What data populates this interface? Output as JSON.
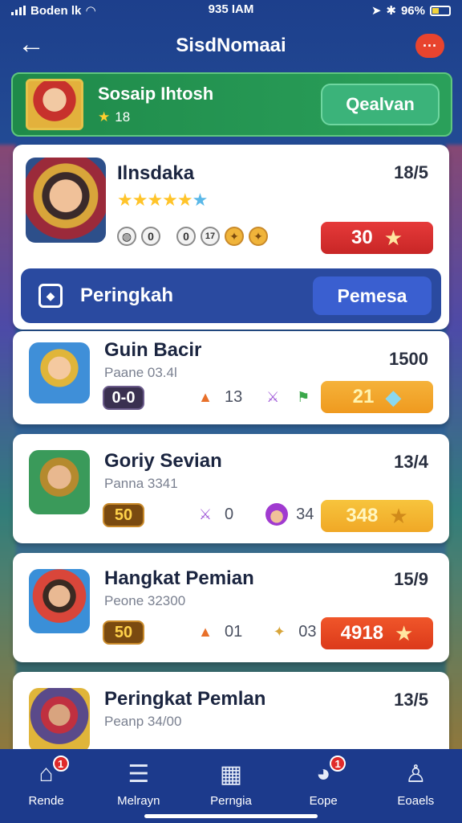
{
  "status": {
    "carrier": "Boden lk",
    "time": "935 IAM",
    "battery": "96%"
  },
  "header": {
    "title": "SisdNomaai",
    "back_icon": "back-arrow-icon",
    "chat_icon": "chat-bubble-icon",
    "chat_label": "···"
  },
  "banner": {
    "title": "Sosaip Ihtosh",
    "star_count": "18",
    "button": "Qealvan"
  },
  "hero_card": {
    "name": "Ilnsdaka",
    "score": "18/5",
    "stars": "★★★★★",
    "star_extra": "★",
    "coins": [
      "0",
      "0",
      "0",
      "17"
    ],
    "reward": "30"
  },
  "rank_bar": {
    "label": "Peringkah",
    "button": "Pemesa"
  },
  "players": [
    {
      "name": "Guin Bacir",
      "sub": "Paane 03.4l",
      "score": "1500",
      "chip": "0-0",
      "stat1": "13",
      "reward": "21"
    },
    {
      "name": "Goriy Sevian",
      "sub": "Panna 3341",
      "score": "13/4",
      "chip": "50",
      "stat1": "0",
      "stat2": "34",
      "reward": "348"
    },
    {
      "name": "Hangkat Pemian",
      "sub": "Peone 32300",
      "score": "15/9",
      "chip": "50",
      "stat1": "01",
      "stat2": "03",
      "reward": "4918"
    },
    {
      "name": "Peringkat Pemlan",
      "sub": "Peanp 34/00",
      "score": "13/5"
    }
  ],
  "nav": [
    {
      "label": "Rende",
      "icon": "home-icon",
      "badge": "1"
    },
    {
      "label": "Melrayn",
      "icon": "list-icon"
    },
    {
      "label": "Perngia",
      "icon": "grid-icon"
    },
    {
      "label": "Eope",
      "icon": "chart-icon",
      "badge": "1"
    },
    {
      "label": "Eoaels",
      "icon": "profile-icon"
    }
  ]
}
